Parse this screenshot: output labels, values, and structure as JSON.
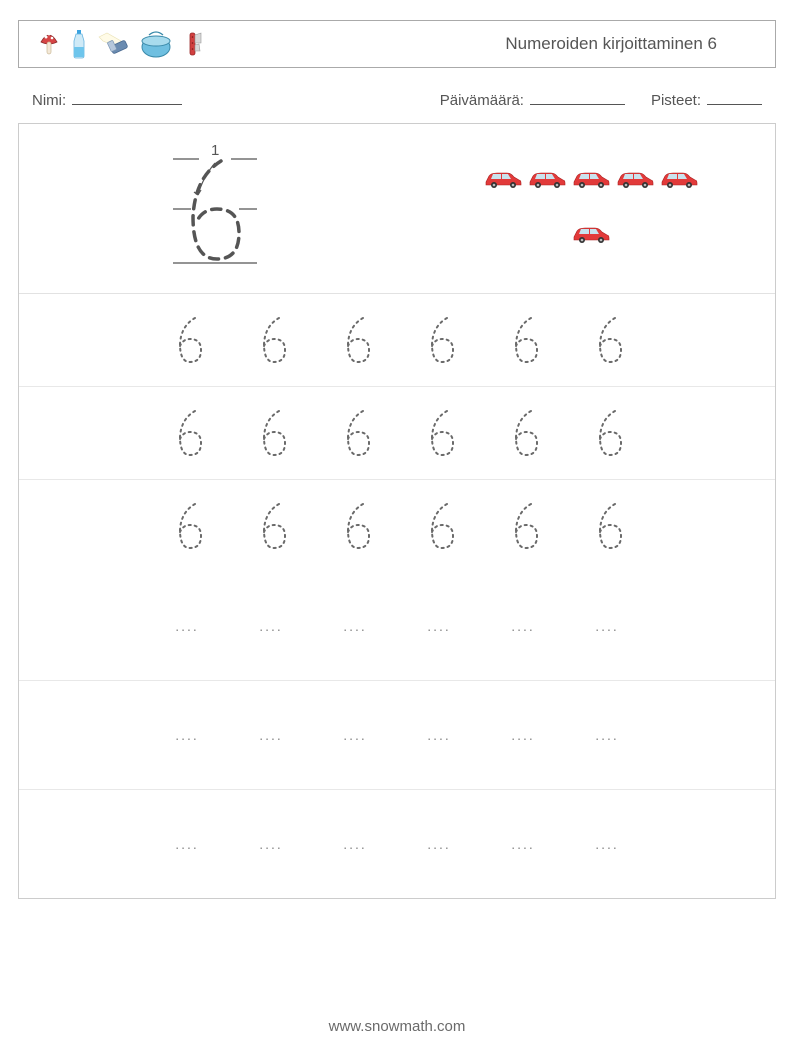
{
  "header": {
    "title": "Numeroiden kirjoittaminen 6",
    "icons": [
      "mushroom",
      "bottle",
      "flashlight",
      "pot",
      "knife"
    ]
  },
  "meta": {
    "name_label": "Nimi:",
    "date_label": "Päivämäärä:",
    "score_label": "Pisteet:"
  },
  "example": {
    "stroke_label": "1",
    "digit": "6",
    "car_count_row1": 5,
    "car_count_row2": 1
  },
  "practice": {
    "trace_rows": 3,
    "cols": 6,
    "blank_rows": 3,
    "digit": "6",
    "placeholder": "...."
  },
  "footer": {
    "url": "www.snowmath.com"
  }
}
